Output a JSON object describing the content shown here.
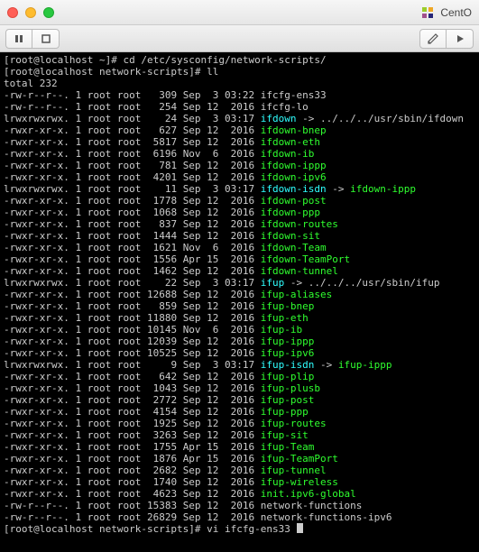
{
  "title_right": "CentO",
  "prompt1": "[root@localhost ~]# ",
  "cmd1": "cd /etc/sysconfig/network-scripts/",
  "prompt2": "[root@localhost network-scripts]# ",
  "cmd2": "ll",
  "total_line": "total 232",
  "prompt3": "[root@localhost network-scripts]# ",
  "cmd3": "vi ifcfg-ens33 ",
  "rows": [
    {
      "p": "-rw-r--r--.",
      "l": "1",
      "u": "root",
      "g": "root",
      "s": "309",
      "d": "Sep  3 03:22",
      "n": "ifcfg-ens33",
      "c": "plain"
    },
    {
      "p": "-rw-r--r--.",
      "l": "1",
      "u": "root",
      "g": "root",
      "s": "254",
      "d": "Sep 12  2016",
      "n": "ifcfg-lo",
      "c": "plain"
    },
    {
      "p": "lrwxrwxrwx.",
      "l": "1",
      "u": "root",
      "g": "root",
      "s": "24",
      "d": "Sep  3 03:17",
      "n": "ifdown",
      "c": "cyan",
      "t": "../../../usr/sbin/ifdown",
      "tc": "plain"
    },
    {
      "p": "-rwxr-xr-x.",
      "l": "1",
      "u": "root",
      "g": "root",
      "s": "627",
      "d": "Sep 12  2016",
      "n": "ifdown-bnep",
      "c": "green"
    },
    {
      "p": "-rwxr-xr-x.",
      "l": "1",
      "u": "root",
      "g": "root",
      "s": "5817",
      "d": "Sep 12  2016",
      "n": "ifdown-eth",
      "c": "green"
    },
    {
      "p": "-rwxr-xr-x.",
      "l": "1",
      "u": "root",
      "g": "root",
      "s": "6196",
      "d": "Nov  6  2016",
      "n": "ifdown-ib",
      "c": "green"
    },
    {
      "p": "-rwxr-xr-x.",
      "l": "1",
      "u": "root",
      "g": "root",
      "s": "781",
      "d": "Sep 12  2016",
      "n": "ifdown-ippp",
      "c": "green"
    },
    {
      "p": "-rwxr-xr-x.",
      "l": "1",
      "u": "root",
      "g": "root",
      "s": "4201",
      "d": "Sep 12  2016",
      "n": "ifdown-ipv6",
      "c": "green"
    },
    {
      "p": "lrwxrwxrwx.",
      "l": "1",
      "u": "root",
      "g": "root",
      "s": "11",
      "d": "Sep  3 03:17",
      "n": "ifdown-isdn",
      "c": "cyan",
      "t": "ifdown-ippp",
      "tc": "green"
    },
    {
      "p": "-rwxr-xr-x.",
      "l": "1",
      "u": "root",
      "g": "root",
      "s": "1778",
      "d": "Sep 12  2016",
      "n": "ifdown-post",
      "c": "green"
    },
    {
      "p": "-rwxr-xr-x.",
      "l": "1",
      "u": "root",
      "g": "root",
      "s": "1068",
      "d": "Sep 12  2016",
      "n": "ifdown-ppp",
      "c": "green"
    },
    {
      "p": "-rwxr-xr-x.",
      "l": "1",
      "u": "root",
      "g": "root",
      "s": "837",
      "d": "Sep 12  2016",
      "n": "ifdown-routes",
      "c": "green"
    },
    {
      "p": "-rwxr-xr-x.",
      "l": "1",
      "u": "root",
      "g": "root",
      "s": "1444",
      "d": "Sep 12  2016",
      "n": "ifdown-sit",
      "c": "green"
    },
    {
      "p": "-rwxr-xr-x.",
      "l": "1",
      "u": "root",
      "g": "root",
      "s": "1621",
      "d": "Nov  6  2016",
      "n": "ifdown-Team",
      "c": "green"
    },
    {
      "p": "-rwxr-xr-x.",
      "l": "1",
      "u": "root",
      "g": "root",
      "s": "1556",
      "d": "Apr 15  2016",
      "n": "ifdown-TeamPort",
      "c": "green"
    },
    {
      "p": "-rwxr-xr-x.",
      "l": "1",
      "u": "root",
      "g": "root",
      "s": "1462",
      "d": "Sep 12  2016",
      "n": "ifdown-tunnel",
      "c": "green"
    },
    {
      "p": "lrwxrwxrwx.",
      "l": "1",
      "u": "root",
      "g": "root",
      "s": "22",
      "d": "Sep  3 03:17",
      "n": "ifup",
      "c": "cyan",
      "t": "../../../usr/sbin/ifup",
      "tc": "plain"
    },
    {
      "p": "-rwxr-xr-x.",
      "l": "1",
      "u": "root",
      "g": "root",
      "s": "12688",
      "d": "Sep 12  2016",
      "n": "ifup-aliases",
      "c": "green"
    },
    {
      "p": "-rwxr-xr-x.",
      "l": "1",
      "u": "root",
      "g": "root",
      "s": "859",
      "d": "Sep 12  2016",
      "n": "ifup-bnep",
      "c": "green"
    },
    {
      "p": "-rwxr-xr-x.",
      "l": "1",
      "u": "root",
      "g": "root",
      "s": "11880",
      "d": "Sep 12  2016",
      "n": "ifup-eth",
      "c": "green"
    },
    {
      "p": "-rwxr-xr-x.",
      "l": "1",
      "u": "root",
      "g": "root",
      "s": "10145",
      "d": "Nov  6  2016",
      "n": "ifup-ib",
      "c": "green"
    },
    {
      "p": "-rwxr-xr-x.",
      "l": "1",
      "u": "root",
      "g": "root",
      "s": "12039",
      "d": "Sep 12  2016",
      "n": "ifup-ippp",
      "c": "green"
    },
    {
      "p": "-rwxr-xr-x.",
      "l": "1",
      "u": "root",
      "g": "root",
      "s": "10525",
      "d": "Sep 12  2016",
      "n": "ifup-ipv6",
      "c": "green"
    },
    {
      "p": "lrwxrwxrwx.",
      "l": "1",
      "u": "root",
      "g": "root",
      "s": "9",
      "d": "Sep  3 03:17",
      "n": "ifup-isdn",
      "c": "cyan",
      "t": "ifup-ippp",
      "tc": "green"
    },
    {
      "p": "-rwxr-xr-x.",
      "l": "1",
      "u": "root",
      "g": "root",
      "s": "642",
      "d": "Sep 12  2016",
      "n": "ifup-plip",
      "c": "green"
    },
    {
      "p": "-rwxr-xr-x.",
      "l": "1",
      "u": "root",
      "g": "root",
      "s": "1043",
      "d": "Sep 12  2016",
      "n": "ifup-plusb",
      "c": "green"
    },
    {
      "p": "-rwxr-xr-x.",
      "l": "1",
      "u": "root",
      "g": "root",
      "s": "2772",
      "d": "Sep 12  2016",
      "n": "ifup-post",
      "c": "green"
    },
    {
      "p": "-rwxr-xr-x.",
      "l": "1",
      "u": "root",
      "g": "root",
      "s": "4154",
      "d": "Sep 12  2016",
      "n": "ifup-ppp",
      "c": "green"
    },
    {
      "p": "-rwxr-xr-x.",
      "l": "1",
      "u": "root",
      "g": "root",
      "s": "1925",
      "d": "Sep 12  2016",
      "n": "ifup-routes",
      "c": "green"
    },
    {
      "p": "-rwxr-xr-x.",
      "l": "1",
      "u": "root",
      "g": "root",
      "s": "3263",
      "d": "Sep 12  2016",
      "n": "ifup-sit",
      "c": "green"
    },
    {
      "p": "-rwxr-xr-x.",
      "l": "1",
      "u": "root",
      "g": "root",
      "s": "1755",
      "d": "Apr 15  2016",
      "n": "ifup-Team",
      "c": "green"
    },
    {
      "p": "-rwxr-xr-x.",
      "l": "1",
      "u": "root",
      "g": "root",
      "s": "1876",
      "d": "Apr 15  2016",
      "n": "ifup-TeamPort",
      "c": "green"
    },
    {
      "p": "-rwxr-xr-x.",
      "l": "1",
      "u": "root",
      "g": "root",
      "s": "2682",
      "d": "Sep 12  2016",
      "n": "ifup-tunnel",
      "c": "green"
    },
    {
      "p": "-rwxr-xr-x.",
      "l": "1",
      "u": "root",
      "g": "root",
      "s": "1740",
      "d": "Sep 12  2016",
      "n": "ifup-wireless",
      "c": "green"
    },
    {
      "p": "-rwxr-xr-x.",
      "l": "1",
      "u": "root",
      "g": "root",
      "s": "4623",
      "d": "Sep 12  2016",
      "n": "init.ipv6-global",
      "c": "green"
    },
    {
      "p": "-rw-r--r--.",
      "l": "1",
      "u": "root",
      "g": "root",
      "s": "15383",
      "d": "Sep 12  2016",
      "n": "network-functions",
      "c": "plain"
    },
    {
      "p": "-rw-r--r--.",
      "l": "1",
      "u": "root",
      "g": "root",
      "s": "26829",
      "d": "Sep 12  2016",
      "n": "network-functions-ipv6",
      "c": "plain"
    }
  ]
}
